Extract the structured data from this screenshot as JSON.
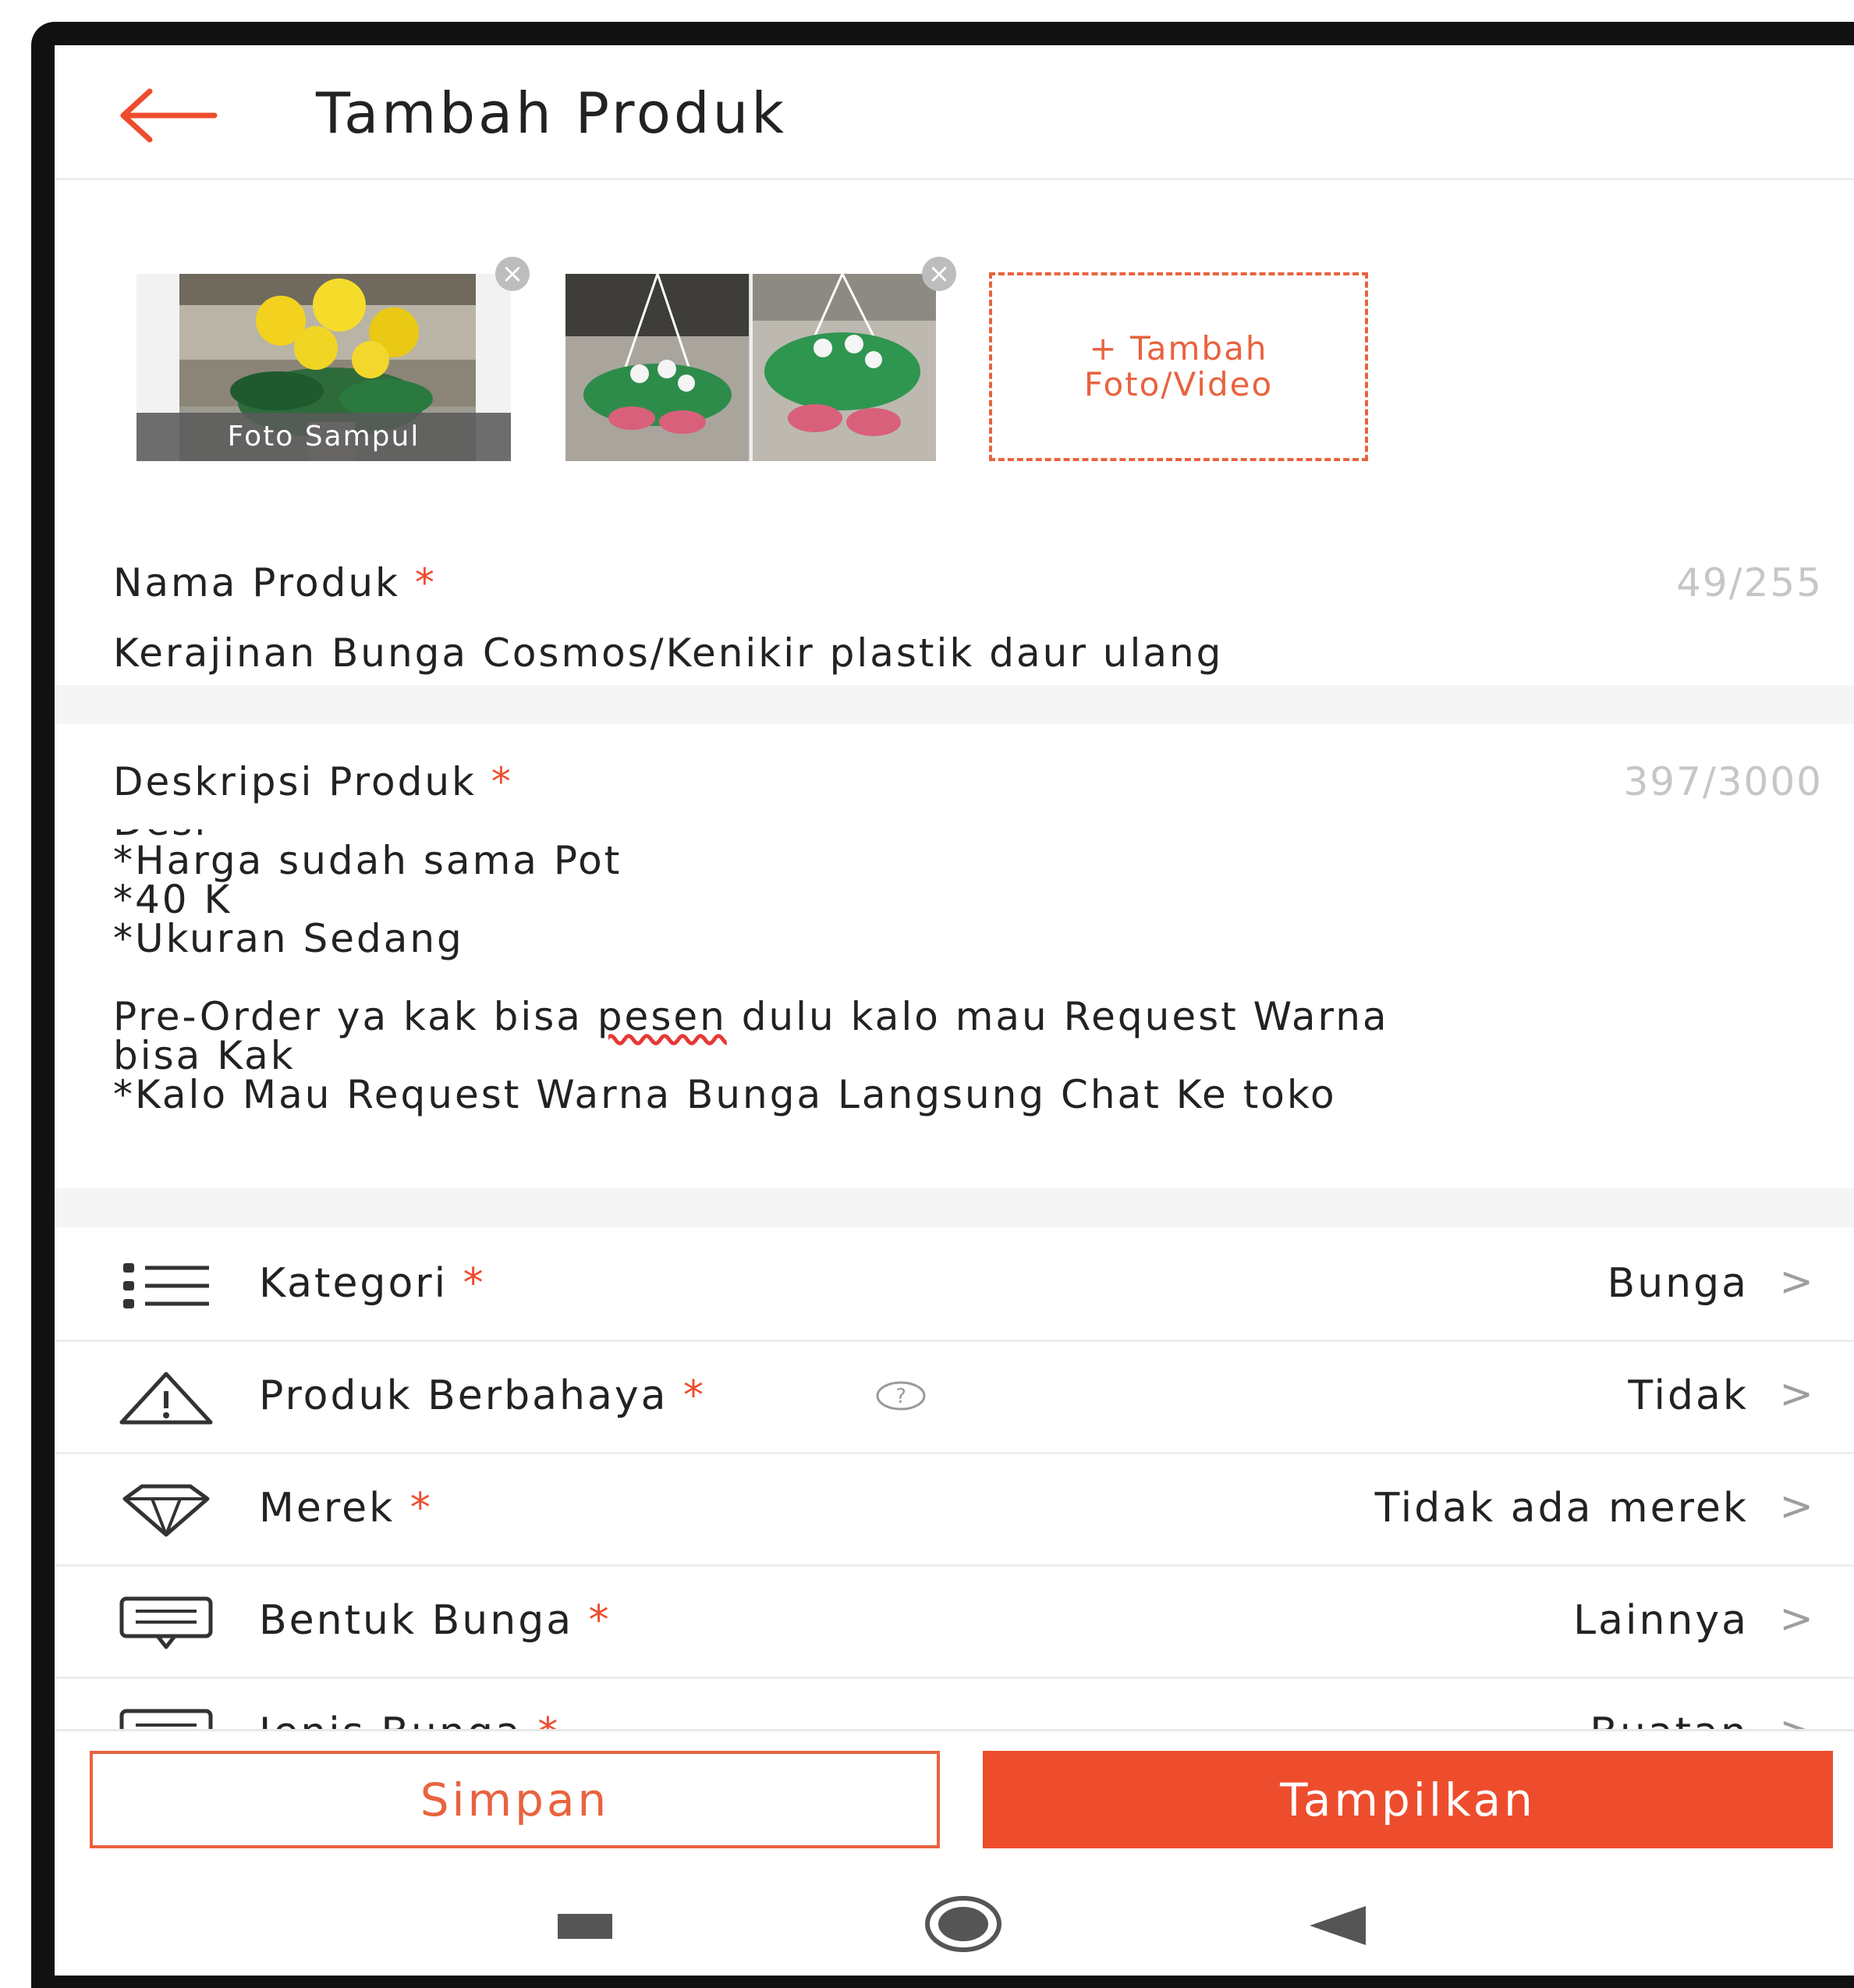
{
  "header": {
    "title": "Tambah Produk"
  },
  "photos": {
    "cover_label": "Foto Sampul",
    "add_label_line1": "+ Tambah",
    "add_label_line2": "Foto/Video"
  },
  "product_name": {
    "label": "Nama Produk",
    "required_mark": "*",
    "counter": "49/255",
    "value": "Kerajinan Bunga Cosmos/Kenikir plastik daur ulang"
  },
  "description": {
    "label": "Deskripsi Produk",
    "required_mark": "*",
    "counter": "397/3000",
    "line_partial": "Desi",
    "line1": "*Harga sudah sama Pot",
    "line2": "*40 K",
    "line3": "*Ukuran Sedang",
    "line4_before": "Pre-Order ya kak bisa ",
    "line4_misspelled": "pesen",
    "line4_after": " dulu kalo mau Request Warna",
    "line5": "bisa Kak",
    "line6": "*Kalo Mau Request Warna Bunga Langsung Chat Ke toko"
  },
  "attributes": [
    {
      "label": "Kategori",
      "required_mark": "*",
      "value": "Bunga",
      "icon": "list-icon"
    },
    {
      "label": "Produk Berbahaya",
      "required_mark": "*",
      "value": "Tidak",
      "icon": "warning-icon"
    },
    {
      "label": "Merek",
      "required_mark": "*",
      "value": "Tidak ada merek",
      "icon": "diamond-icon"
    },
    {
      "label": "Bentuk Bunga",
      "required_mark": "*",
      "value": "Lainnya",
      "icon": "comment-icon"
    },
    {
      "label": "Jenis Bunga",
      "required_mark": "*",
      "value": "Buatan",
      "icon": "message-icon"
    }
  ],
  "chevron": ">",
  "buttons": {
    "save": "Simpan",
    "show": "Tampilkan"
  },
  "colors": {
    "accent": "#ee4d2d",
    "accent_light": "#e8633f",
    "counter": "#c6c6c6"
  }
}
